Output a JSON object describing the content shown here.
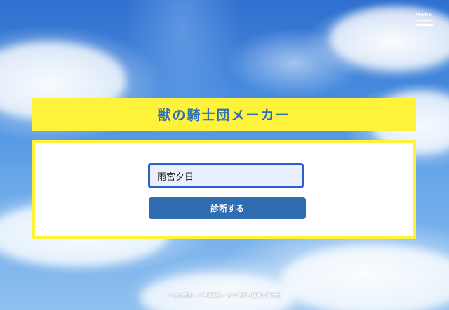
{
  "header": {
    "menu_label": "MENU"
  },
  "main": {
    "title": "獣の騎士団メーカー",
    "name_input": {
      "value": "雨宮夕日",
      "placeholder": ""
    },
    "diagnose_button_label": "診断する"
  },
  "footer": {
    "copyright": "©水上悟志・少年画報社／ある時代の穏輪の騎士団"
  },
  "colors": {
    "accent_yellow": "#fff23a",
    "title_blue": "#2e6fb5",
    "button_blue": "#2f6cb0",
    "input_border": "#2f5fcf"
  }
}
